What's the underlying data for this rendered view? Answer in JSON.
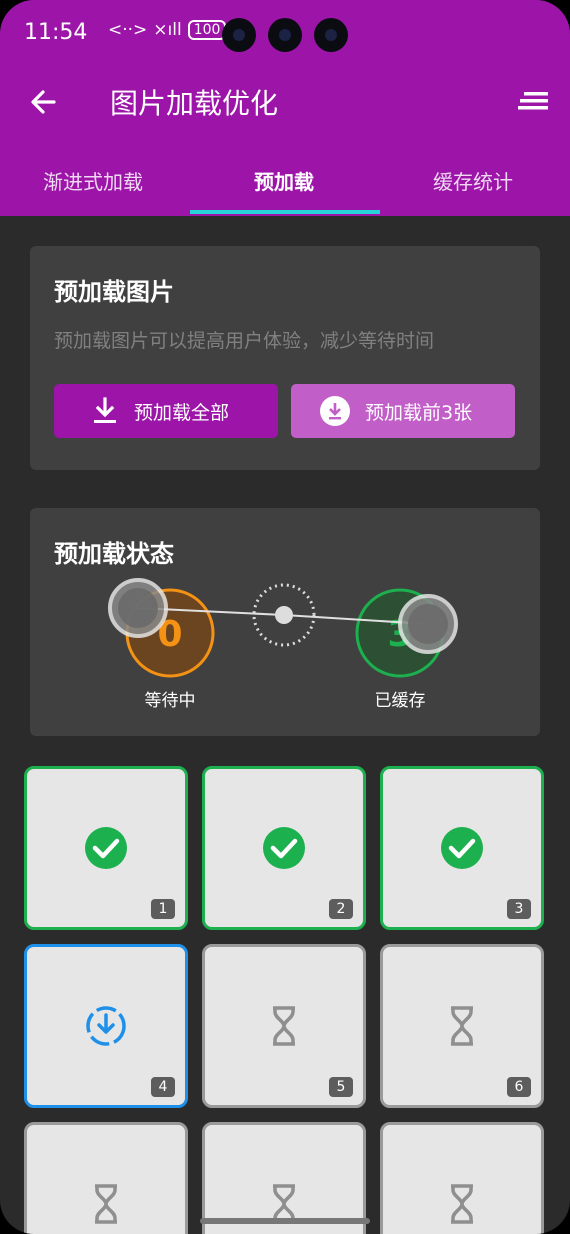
{
  "status_bar": {
    "time": "11:54",
    "network": "<··>",
    "signal": "×ıll",
    "battery": "100"
  },
  "toolbar": {
    "title": "图片加载优化"
  },
  "tabs": [
    {
      "label": "渐进式加载"
    },
    {
      "label": "预加载"
    },
    {
      "label": "缓存统计"
    }
  ],
  "active_tab": "预加载",
  "preload_card": {
    "title": "预加载图片",
    "description": "预加载图片可以提高用户体验，减少等待时间",
    "btn_all": "预加载全部",
    "btn_first3": "预加载前3张"
  },
  "status_card": {
    "title": "预加载状态",
    "waiting_count": "0",
    "waiting_label": "等待中",
    "cached_count": "3",
    "cached_label": "已缓存"
  },
  "grid": [
    {
      "num": "1",
      "state": "done"
    },
    {
      "num": "2",
      "state": "done"
    },
    {
      "num": "3",
      "state": "done"
    },
    {
      "num": "4",
      "state": "loading"
    },
    {
      "num": "5",
      "state": "waiting"
    },
    {
      "num": "6",
      "state": "waiting"
    },
    {
      "num": "",
      "state": "waiting"
    },
    {
      "num": "",
      "state": "waiting"
    },
    {
      "num": "",
      "state": "waiting"
    }
  ],
  "colors": {
    "primary": "#9c15a8",
    "accent": "#27d3d8",
    "success": "#1db04f",
    "loading": "#1e90ea",
    "waiting_orange": "#f39214"
  }
}
